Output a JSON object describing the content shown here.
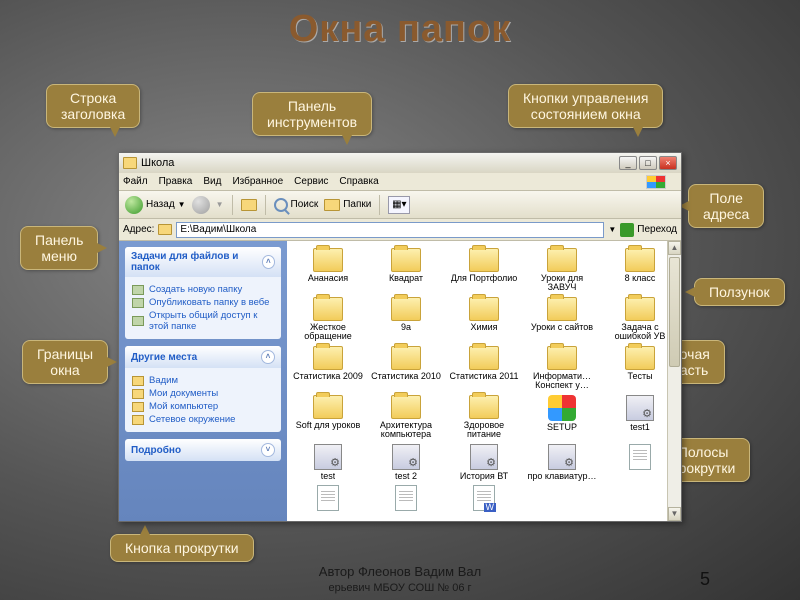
{
  "slide": {
    "title": "Окна папок"
  },
  "callouts": {
    "title_row": "Строка\nзаголовка",
    "toolbar": "Панель\nинструментов",
    "window_buttons": "Кнопки управления\nсостоянием окна",
    "menu_bar": "Панель\nменю",
    "address": "Поле\nадреса",
    "slider": "Ползунок",
    "borders": "Границы\nокна",
    "workspace": "Рабочая\nобласть",
    "scrollbars": "Полосы\nпрокрутки",
    "scroll_button": "Кнопка прокрутки"
  },
  "window": {
    "title": "Школа",
    "menu": [
      "Файл",
      "Правка",
      "Вид",
      "Избранное",
      "Сервис",
      "Справка"
    ],
    "toolbar": {
      "back": "Назад",
      "search": "Поиск",
      "folders": "Папки"
    },
    "address": {
      "label": "Адрес:",
      "value": "E:\\Вадим\\Школа",
      "go": "Переход"
    },
    "side": {
      "tasks_h": "Задачи для файлов и папок",
      "tasks": [
        "Создать новую папку",
        "Опубликовать папку в вебе",
        "Открыть общий доступ к этой папке"
      ],
      "places_h": "Другие места",
      "places": [
        "Вадим",
        "Мои документы",
        "Мой компьютер",
        "Сетевое окружение"
      ],
      "details_h": "Подробно"
    },
    "items": [
      {
        "n": "Ананасия",
        "t": "f"
      },
      {
        "n": "Квадрат",
        "t": "f"
      },
      {
        "n": "Для Портфолио",
        "t": "f"
      },
      {
        "n": "Уроки для ЗАВУЧ",
        "t": "f"
      },
      {
        "n": "8 класс",
        "t": "f"
      },
      {
        "n": "Жесткое обращение",
        "t": "f"
      },
      {
        "n": "9а",
        "t": "f"
      },
      {
        "n": "Химия",
        "t": "f"
      },
      {
        "n": "Уроки с сайтов",
        "t": "f"
      },
      {
        "n": "Задача с ошибкой УВ",
        "t": "f"
      },
      {
        "n": "Статистика 2009",
        "t": "f"
      },
      {
        "n": "Статистика 2010",
        "t": "f"
      },
      {
        "n": "Статистика 2011",
        "t": "f"
      },
      {
        "n": "Информати… Конспект у…",
        "t": "f"
      },
      {
        "n": "Тесты",
        "t": "f"
      },
      {
        "n": "Soft для уроков",
        "t": "f"
      },
      {
        "n": "Архитектура компьютера",
        "t": "f"
      },
      {
        "n": "Здоровое питание",
        "t": "f"
      },
      {
        "n": "SETUP",
        "t": "setup"
      },
      {
        "n": "test1",
        "t": "s"
      },
      {
        "n": "test",
        "t": "s"
      },
      {
        "n": "test 2",
        "t": "s"
      },
      {
        "n": "История ВТ",
        "t": "s"
      },
      {
        "n": "про клавиатур…",
        "t": "s"
      },
      {
        "n": "",
        "t": "d"
      },
      {
        "n": "",
        "t": "d"
      },
      {
        "n": "",
        "t": "d"
      },
      {
        "n": "",
        "t": "dw"
      }
    ]
  },
  "footer": {
    "author": "Автор Флеонов Вадим Вал",
    "author2": "ерьевич МБОУ СОШ № 06 г",
    "page": "5"
  }
}
